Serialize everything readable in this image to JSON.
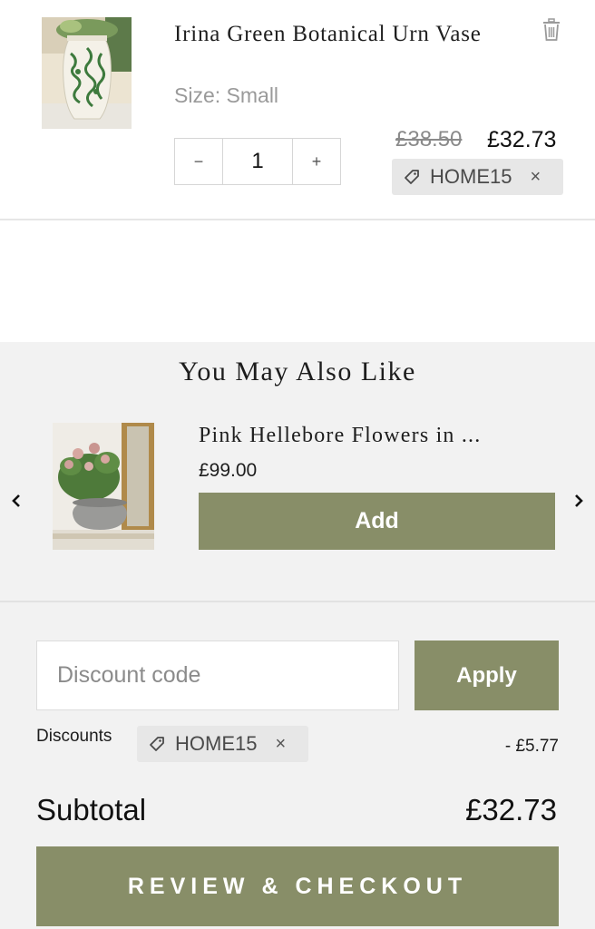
{
  "line_item": {
    "title": "Irina Green Botanical Urn Vase",
    "variant": "Size: Small",
    "quantity": "1",
    "qty_minus": "−",
    "qty_plus": "+",
    "original_price": "£38.50",
    "final_price": "£32.73",
    "discount_code": "HOME15",
    "remove_code": "×",
    "icons": {
      "remove": "trash-icon",
      "tag": "tag-icon"
    }
  },
  "recommendations": {
    "heading": "You May Also Like",
    "product": {
      "title": "Pink Hellebore Flowers in ...",
      "price": "£99.00",
      "add_label": "Add"
    },
    "icons": {
      "prev": "chevron-left-icon",
      "next": "chevron-right-icon"
    }
  },
  "summary": {
    "discount_placeholder": "Discount code",
    "apply_label": "Apply",
    "discounts_label": "Discounts",
    "discount_code": "HOME15",
    "remove_code": "×",
    "discount_amount": "- £5.77",
    "subtotal_label": "Subtotal",
    "subtotal_value": "£32.73",
    "checkout_label": "REVIEW & CHECKOUT"
  },
  "colors": {
    "accent": "#888e68",
    "panel_bg": "#f2f2f2",
    "pill_bg": "#e7e7e7"
  }
}
